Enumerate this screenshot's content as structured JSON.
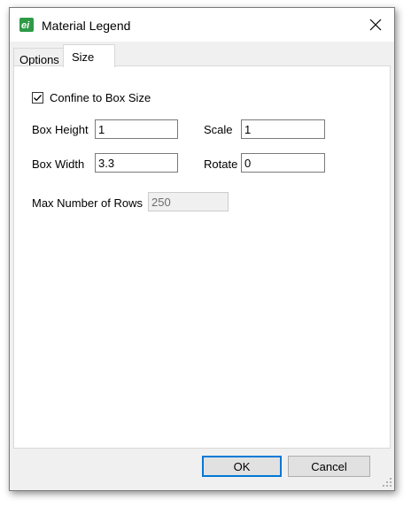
{
  "window": {
    "title": "Material Legend",
    "icon": "app-logo-icon",
    "close_icon": "close-icon"
  },
  "tabs": [
    {
      "label": "Options",
      "selected": false
    },
    {
      "label": "Size",
      "selected": true
    }
  ],
  "size_tab": {
    "confine_checkbox": {
      "label": "Confine to Box Size",
      "checked": true
    },
    "box_height": {
      "label": "Box Height",
      "value": "1"
    },
    "box_width": {
      "label": "Box Width",
      "value": "3.3"
    },
    "scale": {
      "label": "Scale",
      "value": "1"
    },
    "rotate": {
      "label": "Rotate",
      "value": "0"
    },
    "max_rows": {
      "label": "Max Number of Rows",
      "value": "250",
      "disabled": true
    }
  },
  "buttons": {
    "ok": "OK",
    "cancel": "Cancel"
  },
  "colors": {
    "accent": "#0078d7",
    "app_icon": "#2e9a47",
    "dialog_bg": "#f0f0f0"
  }
}
